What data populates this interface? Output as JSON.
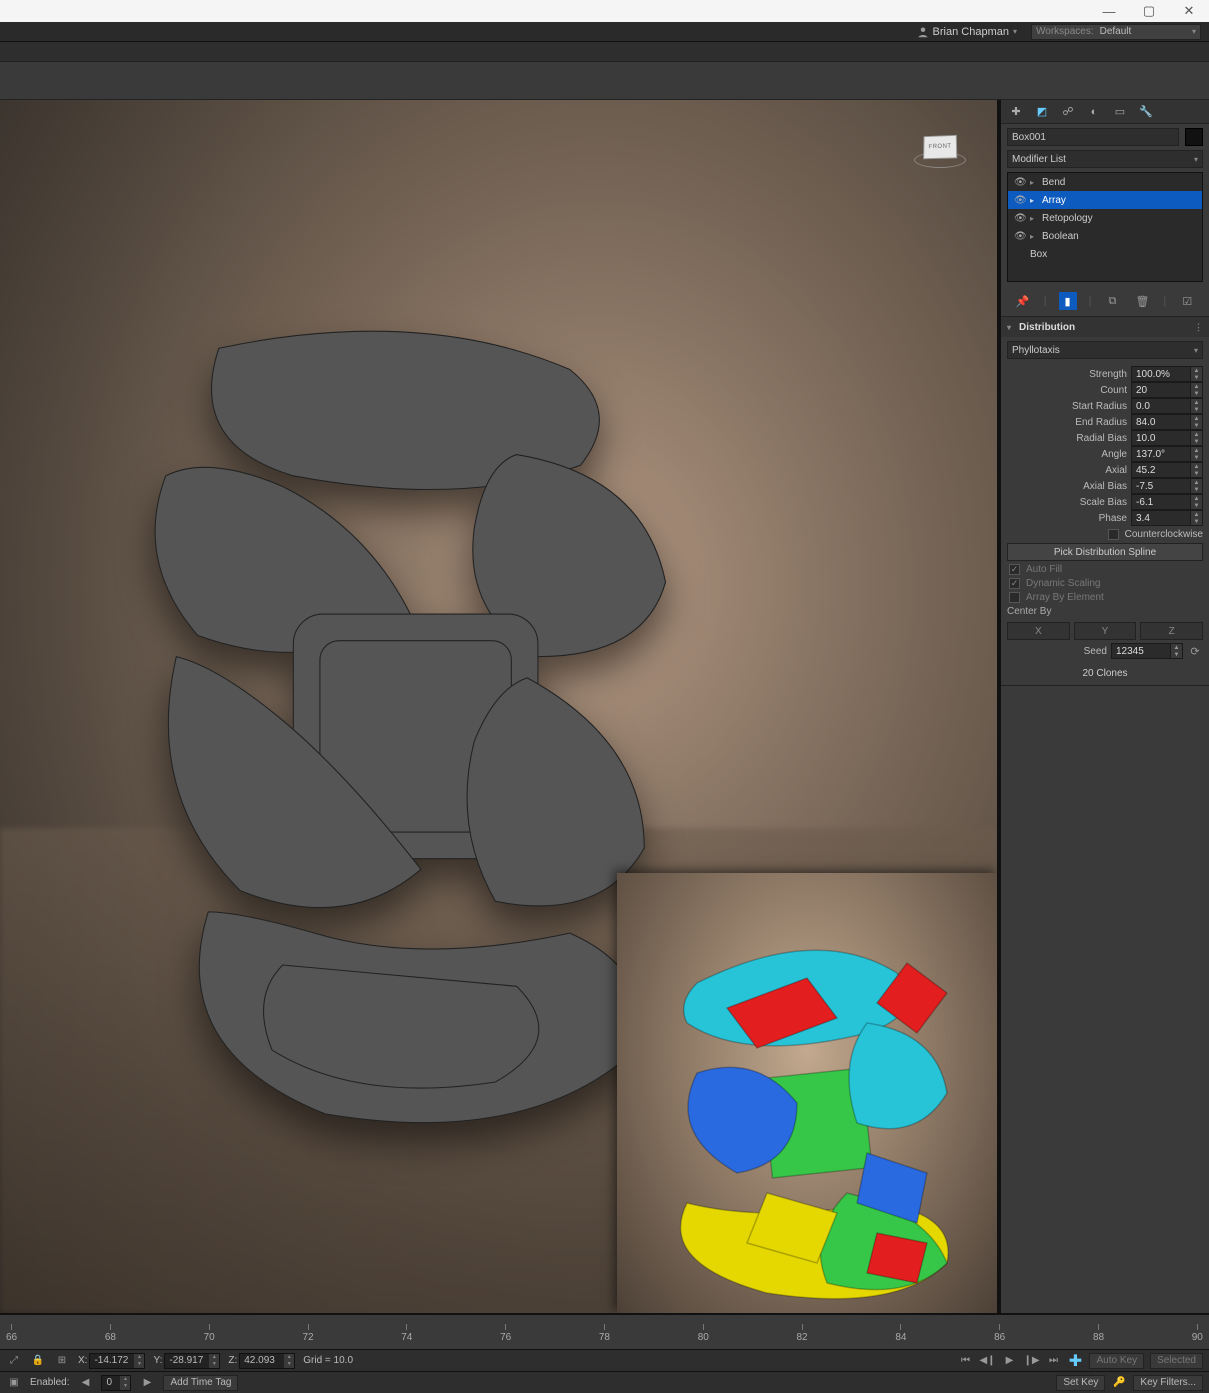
{
  "window": {
    "min": "—",
    "max": "▢",
    "close": "✕"
  },
  "user": "Brian Chapman",
  "workspace_label": "Workspaces:",
  "workspace_value": "Default",
  "viewcube": "FRONT",
  "object_name": "Box001",
  "modifier_list_label": "Modifier List",
  "stack": {
    "items": [
      {
        "name": "Bend",
        "eye": true
      },
      {
        "name": "Array",
        "eye": true,
        "selected": true
      },
      {
        "name": "Retopology",
        "eye": true
      },
      {
        "name": "Boolean",
        "eye": true
      }
    ],
    "base": "Box"
  },
  "rollouts": {
    "distribution": {
      "title": "Distribution",
      "type": "Phyllotaxis",
      "params": [
        {
          "label": "Strength",
          "value": "100.0%"
        },
        {
          "label": "Count",
          "value": "20"
        },
        {
          "label": "Start Radius",
          "value": "0.0"
        },
        {
          "label": "End Radius",
          "value": "84.0"
        },
        {
          "label": "Radial Bias",
          "value": "10.0"
        },
        {
          "label": "Angle",
          "value": "137.0°"
        },
        {
          "label": "Axial",
          "value": "45.2"
        },
        {
          "label": "Axial Bias",
          "value": "-7.5"
        },
        {
          "label": "Scale Bias",
          "value": "-6.1"
        },
        {
          "label": "Phase",
          "value": "3.4"
        }
      ],
      "counterclockwise": "Counterclockwise",
      "pick_spline": "Pick Distribution Spline",
      "auto_fill": "Auto Fill",
      "dynamic_scaling": "Dynamic Scaling",
      "array_by_element": "Array By Element",
      "center_by": "Center By",
      "axes": [
        "X",
        "Y",
        "Z"
      ],
      "seed_label": "Seed",
      "seed_value": "12345",
      "clones": "20 Clones"
    }
  },
  "timeline_ticks": [
    "66",
    "68",
    "70",
    "72",
    "74",
    "76",
    "78",
    "80",
    "82",
    "84",
    "86",
    "88",
    "90"
  ],
  "status": {
    "x_label": "X:",
    "x": "-14.172",
    "y_label": "Y:",
    "y": "-28.917",
    "z_label": "Z:",
    "z": "42.093",
    "grid": "Grid = 10.0",
    "setkey": "Set Key",
    "keyfilters": "Key Filters...",
    "autokey": "Auto Key",
    "selected": "Selected"
  },
  "status2": {
    "enabled": "Enabled:",
    "zero": "0",
    "addtag": "Add Time Tag"
  }
}
